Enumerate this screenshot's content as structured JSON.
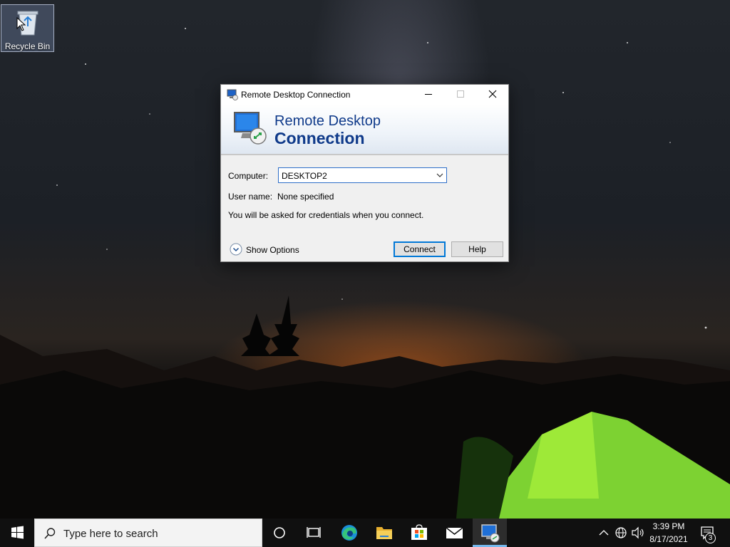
{
  "desktop": {
    "recycle_bin_label": "Recycle Bin"
  },
  "dialog": {
    "title": "Remote Desktop Connection",
    "banner_line1": "Remote Desktop",
    "banner_line2": "Connection",
    "computer_label": "Computer:",
    "computer_value": "DESKTOP2",
    "username_label": "User name:",
    "username_value": "None specified",
    "note": "You will be asked for credentials when you connect.",
    "show_options": "Show Options",
    "connect_button": "Connect",
    "help_button": "Help"
  },
  "taskbar": {
    "search_placeholder": "Type here to search",
    "pinned": [
      "cortana-icon",
      "task-view-icon",
      "edge-icon",
      "file-explorer-icon",
      "store-icon",
      "mail-icon",
      "remote-desktop-icon"
    ],
    "time": "3:39 PM",
    "date": "8/17/2021",
    "notification_count": "3"
  },
  "colors": {
    "accent": "#0078d7",
    "banner_text": "#0f3a8a",
    "taskbar": "#101010"
  }
}
